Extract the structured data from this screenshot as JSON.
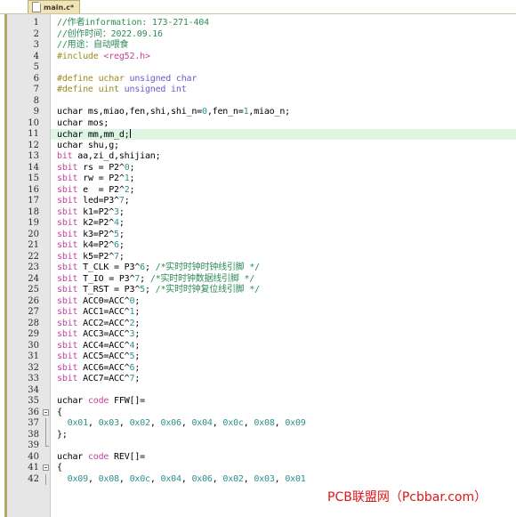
{
  "window": {
    "title": "main.c*"
  },
  "tab": {
    "label": "main.c*",
    "icon": "document-icon",
    "modified": true
  },
  "editor": {
    "current_line": 11,
    "highlight_color": "#ddf5e1",
    "gutter_color": "#e6e6e6",
    "rail_color": "#b3a96a",
    "first_visible_line": 1,
    "last_visible_line": 42,
    "lines": [
      {
        "n": 1,
        "tokens": [
          {
            "t": "cmt",
            "s": "//作者information: 173-271-404"
          }
        ]
      },
      {
        "n": 2,
        "tokens": [
          {
            "t": "cmt",
            "s": "//创作时间：2022.09.16"
          }
        ]
      },
      {
        "n": 3,
        "tokens": [
          {
            "t": "cmt",
            "s": "//用途：自动喂食"
          }
        ]
      },
      {
        "n": 4,
        "tokens": [
          {
            "t": "pre",
            "s": "#include "
          },
          {
            "t": "inc",
            "s": "<reg52.h>"
          }
        ]
      },
      {
        "n": 5,
        "tokens": []
      },
      {
        "n": 6,
        "tokens": [
          {
            "t": "pre",
            "s": "#define uchar "
          },
          {
            "t": "kw",
            "s": "unsigned char"
          }
        ]
      },
      {
        "n": 7,
        "tokens": [
          {
            "t": "pre",
            "s": "#define uint "
          },
          {
            "t": "kw",
            "s": "unsigned int"
          }
        ]
      },
      {
        "n": 8,
        "tokens": []
      },
      {
        "n": 9,
        "tokens": [
          {
            "t": "plain",
            "s": "uchar ms,miao,fen,shi,shi_n="
          },
          {
            "t": "num",
            "s": "0"
          },
          {
            "t": "plain",
            "s": ",fen_n="
          },
          {
            "t": "num",
            "s": "1"
          },
          {
            "t": "plain",
            "s": ",miao_n;"
          }
        ]
      },
      {
        "n": 10,
        "tokens": [
          {
            "t": "plain",
            "s": "uchar mos;"
          }
        ]
      },
      {
        "n": 11,
        "tokens": [
          {
            "t": "plain",
            "s": "uchar mm,mm_d;"
          }
        ],
        "highlight": true,
        "caret": true
      },
      {
        "n": 12,
        "tokens": [
          {
            "t": "plain",
            "s": "uchar shu,g;"
          }
        ]
      },
      {
        "n": 13,
        "tokens": [
          {
            "t": "kw2",
            "s": "bit"
          },
          {
            "t": "plain",
            "s": " aa,zi_d,shijian;"
          }
        ]
      },
      {
        "n": 14,
        "tokens": [
          {
            "t": "kw2",
            "s": "sbit"
          },
          {
            "t": "plain",
            "s": " rs = P2^"
          },
          {
            "t": "num",
            "s": "0"
          },
          {
            "t": "plain",
            "s": ";"
          }
        ]
      },
      {
        "n": 15,
        "tokens": [
          {
            "t": "kw2",
            "s": "sbit"
          },
          {
            "t": "plain",
            "s": " rw = P2^"
          },
          {
            "t": "num",
            "s": "1"
          },
          {
            "t": "plain",
            "s": ";"
          }
        ]
      },
      {
        "n": 16,
        "tokens": [
          {
            "t": "kw2",
            "s": "sbit"
          },
          {
            "t": "plain",
            "s": " e  = P2^"
          },
          {
            "t": "num",
            "s": "2"
          },
          {
            "t": "plain",
            "s": ";"
          }
        ]
      },
      {
        "n": 17,
        "tokens": [
          {
            "t": "kw2",
            "s": "sbit"
          },
          {
            "t": "plain",
            "s": " led=P3^"
          },
          {
            "t": "num",
            "s": "7"
          },
          {
            "t": "plain",
            "s": ";"
          }
        ]
      },
      {
        "n": 18,
        "tokens": [
          {
            "t": "kw2",
            "s": "sbit"
          },
          {
            "t": "plain",
            "s": " k1=P2^"
          },
          {
            "t": "num",
            "s": "3"
          },
          {
            "t": "plain",
            "s": ";"
          }
        ]
      },
      {
        "n": 19,
        "tokens": [
          {
            "t": "kw2",
            "s": "sbit"
          },
          {
            "t": "plain",
            "s": " k2=P2^"
          },
          {
            "t": "num",
            "s": "4"
          },
          {
            "t": "plain",
            "s": ";"
          }
        ]
      },
      {
        "n": 20,
        "tokens": [
          {
            "t": "kw2",
            "s": "sbit"
          },
          {
            "t": "plain",
            "s": " k3=P2^"
          },
          {
            "t": "num",
            "s": "5"
          },
          {
            "t": "plain",
            "s": ";"
          }
        ]
      },
      {
        "n": 21,
        "tokens": [
          {
            "t": "kw2",
            "s": "sbit"
          },
          {
            "t": "plain",
            "s": " k4=P2^"
          },
          {
            "t": "num",
            "s": "6"
          },
          {
            "t": "plain",
            "s": ";"
          }
        ]
      },
      {
        "n": 22,
        "tokens": [
          {
            "t": "kw2",
            "s": "sbit"
          },
          {
            "t": "plain",
            "s": " k5=P2^"
          },
          {
            "t": "num",
            "s": "7"
          },
          {
            "t": "plain",
            "s": ";"
          }
        ]
      },
      {
        "n": 23,
        "tokens": [
          {
            "t": "kw2",
            "s": "sbit"
          },
          {
            "t": "plain",
            "s": " T_CLK = P3^"
          },
          {
            "t": "num",
            "s": "6"
          },
          {
            "t": "plain",
            "s": "; "
          },
          {
            "t": "cmt",
            "s": "/*实时时钟时钟线引脚 */"
          }
        ]
      },
      {
        "n": 24,
        "tokens": [
          {
            "t": "kw2",
            "s": "sbit"
          },
          {
            "t": "plain",
            "s": " T_IO = P3^"
          },
          {
            "t": "num",
            "s": "7"
          },
          {
            "t": "plain",
            "s": "; "
          },
          {
            "t": "cmt",
            "s": "/*实时时钟数据线引脚 */"
          }
        ]
      },
      {
        "n": 25,
        "tokens": [
          {
            "t": "kw2",
            "s": "sbit"
          },
          {
            "t": "plain",
            "s": " T_RST = P3^"
          },
          {
            "t": "num",
            "s": "5"
          },
          {
            "t": "plain",
            "s": "; "
          },
          {
            "t": "cmt",
            "s": "/*实时时钟复位线引脚 */"
          }
        ]
      },
      {
        "n": 26,
        "tokens": [
          {
            "t": "kw2",
            "s": "sbit"
          },
          {
            "t": "plain",
            "s": " ACC0=ACC^"
          },
          {
            "t": "num",
            "s": "0"
          },
          {
            "t": "plain",
            "s": ";"
          }
        ]
      },
      {
        "n": 27,
        "tokens": [
          {
            "t": "kw2",
            "s": "sbit"
          },
          {
            "t": "plain",
            "s": " ACC1=ACC^"
          },
          {
            "t": "num",
            "s": "1"
          },
          {
            "t": "plain",
            "s": ";"
          }
        ]
      },
      {
        "n": 28,
        "tokens": [
          {
            "t": "kw2",
            "s": "sbit"
          },
          {
            "t": "plain",
            "s": " ACC2=ACC^"
          },
          {
            "t": "num",
            "s": "2"
          },
          {
            "t": "plain",
            "s": ";"
          }
        ]
      },
      {
        "n": 29,
        "tokens": [
          {
            "t": "kw2",
            "s": "sbit"
          },
          {
            "t": "plain",
            "s": " ACC3=ACC^"
          },
          {
            "t": "num",
            "s": "3"
          },
          {
            "t": "plain",
            "s": ";"
          }
        ]
      },
      {
        "n": 30,
        "tokens": [
          {
            "t": "kw2",
            "s": "sbit"
          },
          {
            "t": "plain",
            "s": " ACC4=ACC^"
          },
          {
            "t": "num",
            "s": "4"
          },
          {
            "t": "plain",
            "s": ";"
          }
        ]
      },
      {
        "n": 31,
        "tokens": [
          {
            "t": "kw2",
            "s": "sbit"
          },
          {
            "t": "plain",
            "s": " ACC5=ACC^"
          },
          {
            "t": "num",
            "s": "5"
          },
          {
            "t": "plain",
            "s": ";"
          }
        ]
      },
      {
        "n": 32,
        "tokens": [
          {
            "t": "kw2",
            "s": "sbit"
          },
          {
            "t": "plain",
            "s": " ACC6=ACC^"
          },
          {
            "t": "num",
            "s": "6"
          },
          {
            "t": "plain",
            "s": ";"
          }
        ]
      },
      {
        "n": 33,
        "tokens": [
          {
            "t": "kw2",
            "s": "sbit"
          },
          {
            "t": "plain",
            "s": " ACC7=ACC^"
          },
          {
            "t": "num",
            "s": "7"
          },
          {
            "t": "plain",
            "s": ";"
          }
        ]
      },
      {
        "n": 34,
        "tokens": []
      },
      {
        "n": 35,
        "tokens": [
          {
            "t": "plain",
            "s": "uchar "
          },
          {
            "t": "kw2",
            "s": "code"
          },
          {
            "t": "plain",
            "s": " FFW[]="
          }
        ]
      },
      {
        "n": 36,
        "tokens": [
          {
            "t": "plain",
            "s": "{"
          }
        ],
        "fold": "start"
      },
      {
        "n": 37,
        "tokens": [
          {
            "t": "plain",
            "s": "  "
          },
          {
            "t": "hex",
            "s": "0x01"
          },
          {
            "t": "plain",
            "s": ", "
          },
          {
            "t": "hex",
            "s": "0x03"
          },
          {
            "t": "plain",
            "s": ", "
          },
          {
            "t": "hex",
            "s": "0x02"
          },
          {
            "t": "plain",
            "s": ", "
          },
          {
            "t": "hex",
            "s": "0x06"
          },
          {
            "t": "plain",
            "s": ", "
          },
          {
            "t": "hex",
            "s": "0x04"
          },
          {
            "t": "plain",
            "s": ", "
          },
          {
            "t": "hex",
            "s": "0x0c"
          },
          {
            "t": "plain",
            "s": ", "
          },
          {
            "t": "hex",
            "s": "0x08"
          },
          {
            "t": "plain",
            "s": ", "
          },
          {
            "t": "hex",
            "s": "0x09"
          }
        ],
        "fold": "mid"
      },
      {
        "n": 38,
        "tokens": [
          {
            "t": "plain",
            "s": "};"
          }
        ],
        "fold": "end"
      },
      {
        "n": 39,
        "tokens": [],
        "fold": "tail"
      },
      {
        "n": 40,
        "tokens": [
          {
            "t": "plain",
            "s": "uchar "
          },
          {
            "t": "kw2",
            "s": "code"
          },
          {
            "t": "plain",
            "s": " REV[]="
          }
        ]
      },
      {
        "n": 41,
        "tokens": [
          {
            "t": "plain",
            "s": "{"
          }
        ],
        "fold": "start"
      },
      {
        "n": 42,
        "tokens": [
          {
            "t": "plain",
            "s": "  "
          },
          {
            "t": "hex",
            "s": "0x09"
          },
          {
            "t": "plain",
            "s": ", "
          },
          {
            "t": "hex",
            "s": "0x08"
          },
          {
            "t": "plain",
            "s": ", "
          },
          {
            "t": "hex",
            "s": "0x0c"
          },
          {
            "t": "plain",
            "s": ", "
          },
          {
            "t": "hex",
            "s": "0x04"
          },
          {
            "t": "plain",
            "s": ", "
          },
          {
            "t": "hex",
            "s": "0x06"
          },
          {
            "t": "plain",
            "s": ", "
          },
          {
            "t": "hex",
            "s": "0x02"
          },
          {
            "t": "plain",
            "s": ", "
          },
          {
            "t": "hex",
            "s": "0x03"
          },
          {
            "t": "plain",
            "s": ", "
          },
          {
            "t": "hex",
            "s": "0x01"
          }
        ],
        "fold": "mid"
      }
    ]
  },
  "watermark": {
    "text": "PCB联盟网（Pcbbar.com）",
    "color": "#e11515"
  },
  "colors": {
    "comment": "#2e8b57",
    "preprocessor": "#9a8b1e",
    "include_path": "#c2449c",
    "keyword": "#6a5acd",
    "keyword_type": "#c2449c",
    "number": "#2f8f8f",
    "text": "#000000",
    "tab_active_bg": "#f0e3b4"
  }
}
